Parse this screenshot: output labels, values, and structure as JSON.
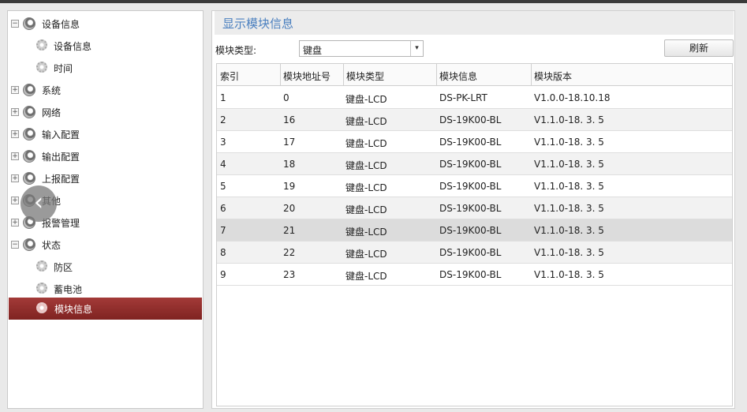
{
  "sidebar": {
    "items": [
      {
        "label": "设备信息",
        "kind": "parent",
        "toggle": "−"
      },
      {
        "label": "设备信息",
        "kind": "child"
      },
      {
        "label": "时间",
        "kind": "child"
      },
      {
        "label": "系统",
        "kind": "parent",
        "toggle": "+"
      },
      {
        "label": "网络",
        "kind": "parent",
        "toggle": "+"
      },
      {
        "label": "输入配置",
        "kind": "parent",
        "toggle": "+"
      },
      {
        "label": "输出配置",
        "kind": "parent",
        "toggle": "+"
      },
      {
        "label": "上报配置",
        "kind": "parent",
        "toggle": "+"
      },
      {
        "label": "其他",
        "kind": "parent",
        "toggle": "+"
      },
      {
        "label": "报警管理",
        "kind": "parent",
        "toggle": "+"
      },
      {
        "label": "状态",
        "kind": "parent",
        "toggle": "−"
      },
      {
        "label": "防区",
        "kind": "child"
      },
      {
        "label": "蓄电池",
        "kind": "child"
      },
      {
        "label": "模块信息",
        "kind": "child",
        "selected": true
      }
    ]
  },
  "main": {
    "title": "显示模块信息",
    "filter": {
      "label": "模块类型:",
      "value": "键盘"
    },
    "refresh_label": "刷新",
    "columns": [
      "索引",
      "模块地址号",
      "模块类型",
      "模块信息",
      "模块版本"
    ],
    "rows": [
      [
        "1",
        "0",
        "键盘-LCD",
        "DS-PK-LRT",
        "V1.0.0-18.10.18"
      ],
      [
        "2",
        "16",
        "键盘-LCD",
        "DS-19K00-BL",
        "V1.1.0-18. 3. 5"
      ],
      [
        "3",
        "17",
        "键盘-LCD",
        "DS-19K00-BL",
        "V1.1.0-18. 3. 5"
      ],
      [
        "4",
        "18",
        "键盘-LCD",
        "DS-19K00-BL",
        "V1.1.0-18. 3. 5"
      ],
      [
        "5",
        "19",
        "键盘-LCD",
        "DS-19K00-BL",
        "V1.1.0-18. 3. 5"
      ],
      [
        "6",
        "20",
        "键盘-LCD",
        "DS-19K00-BL",
        "V1.1.0-18. 3. 5"
      ],
      [
        "7",
        "21",
        "键盘-LCD",
        "DS-19K00-BL",
        "V1.1.0-18. 3. 5"
      ],
      [
        "8",
        "22",
        "键盘-LCD",
        "DS-19K00-BL",
        "V1.1.0-18. 3. 5"
      ],
      [
        "9",
        "23",
        "键盘-LCD",
        "DS-19K00-BL",
        "V1.1.0-18. 3. 5"
      ]
    ],
    "highlighted_row": 6
  },
  "colors": {
    "selected_bg": "#8f2c2a",
    "title_text": "#4a7fbf"
  }
}
